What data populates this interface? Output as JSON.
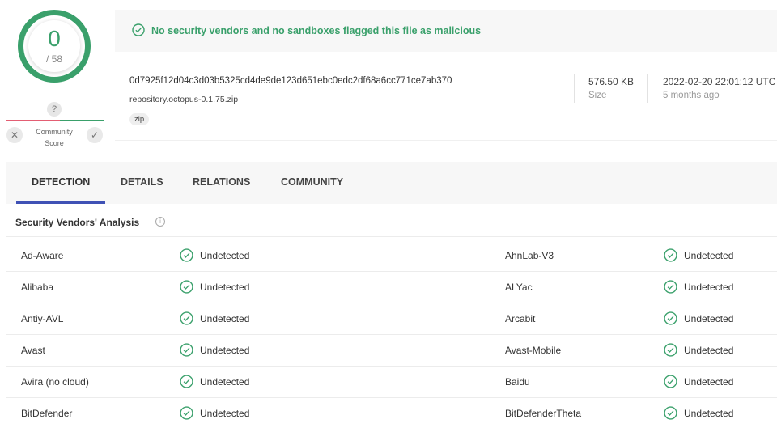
{
  "score": {
    "detections": "0",
    "total": "/ 58"
  },
  "community": {
    "question": "?",
    "label_line1": "Community",
    "label_line2": "Score"
  },
  "banner": {
    "message": "No security vendors and no sandboxes flagged this file as malicious"
  },
  "file": {
    "hash": "0d7925f12d04c3d03b5325cd4de9de123d651ebc0edc2df68a6cc771ce7ab370",
    "name": "repository.octopus-0.1.75.zip",
    "tag": "zip",
    "size_value": "576.50 KB",
    "size_label": "Size",
    "date_value": "2022-02-20 22:01:12 UTC",
    "date_ago": "5 months ago"
  },
  "tabs": [
    {
      "label": "DETECTION"
    },
    {
      "label": "DETAILS"
    },
    {
      "label": "RELATIONS"
    },
    {
      "label": "COMMUNITY"
    }
  ],
  "section": {
    "title": "Security Vendors' Analysis"
  },
  "vendors": [
    {
      "left_name": "Ad-Aware",
      "left_result": "Undetected",
      "right_name": "AhnLab-V3",
      "right_result": "Undetected"
    },
    {
      "left_name": "Alibaba",
      "left_result": "Undetected",
      "right_name": "ALYac",
      "right_result": "Undetected"
    },
    {
      "left_name": "Antiy-AVL",
      "left_result": "Undetected",
      "right_name": "Arcabit",
      "right_result": "Undetected"
    },
    {
      "left_name": "Avast",
      "left_result": "Undetected",
      "right_name": "Avast-Mobile",
      "right_result": "Undetected"
    },
    {
      "left_name": "Avira (no cloud)",
      "left_result": "Undetected",
      "right_name": "Baidu",
      "right_result": "Undetected"
    },
    {
      "left_name": "BitDefender",
      "left_result": "Undetected",
      "right_name": "BitDefenderTheta",
      "right_result": "Undetected"
    }
  ],
  "colors": {
    "clean": "#3aa06b",
    "malicious": "#e35e73",
    "tab_active": "#3f51b5"
  },
  "icons": {
    "clean": "check-circle-icon",
    "info": "info-icon",
    "vote_bad": "close-icon",
    "vote_good": "check-icon"
  }
}
